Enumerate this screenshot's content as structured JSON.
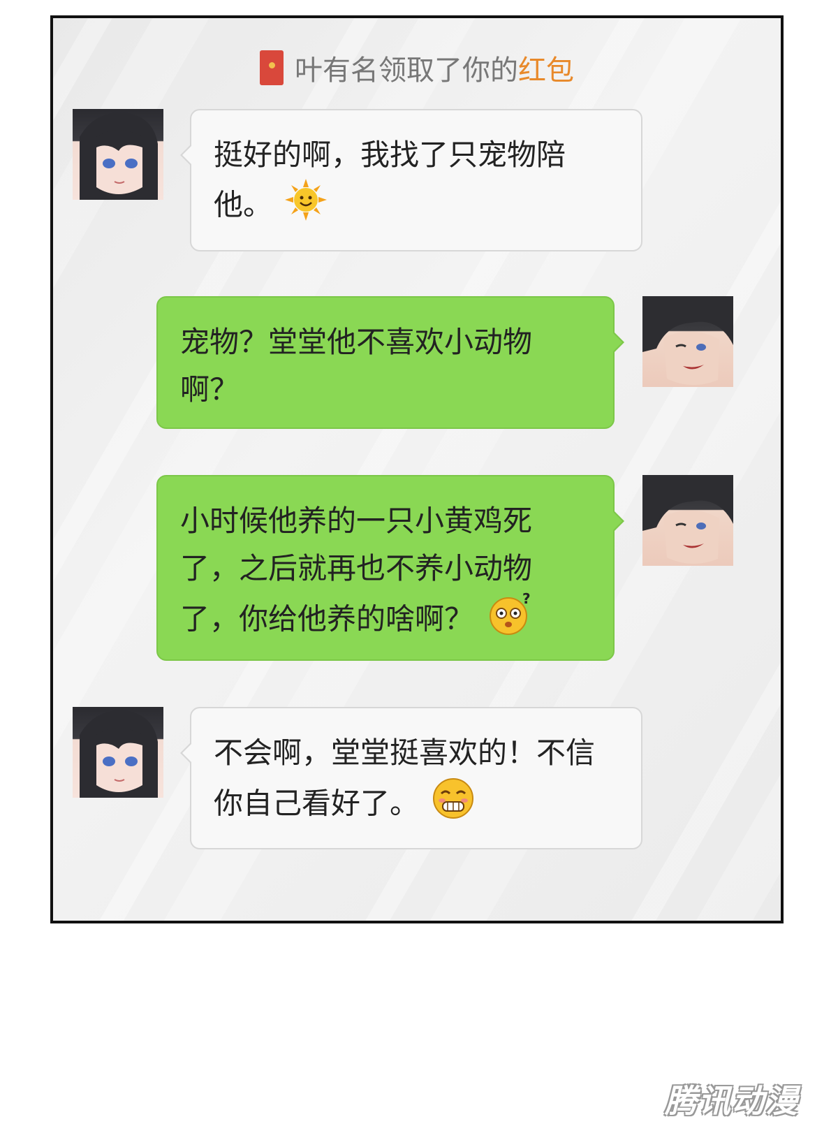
{
  "notice": {
    "prefix": "叶有名领取了你的",
    "highlight": "红包"
  },
  "messages": [
    {
      "side": "left",
      "lines": [
        "挺好的啊，我找了只宠物陪",
        "他。"
      ],
      "emoji": "sun-face-icon"
    },
    {
      "side": "right",
      "lines": [
        "宠物？堂堂他不喜欢小动物",
        "啊？"
      ],
      "emoji": null
    },
    {
      "side": "right",
      "lines": [
        "小时候他养的一只小黄鸡死",
        "了，之后就再也不养小动物",
        "了，你给他养的啥啊？"
      ],
      "emoji": "confused-face-icon"
    },
    {
      "side": "left",
      "lines": [
        "不会啊，堂堂挺喜欢的！不信",
        "你自己看好了。"
      ],
      "emoji": "grinning-face-icon"
    }
  ],
  "watermark": "腾讯动漫",
  "colors": {
    "green_bubble": "#8ad854",
    "white_bubble": "#f8f8f8",
    "highlight": "#e8892a"
  }
}
